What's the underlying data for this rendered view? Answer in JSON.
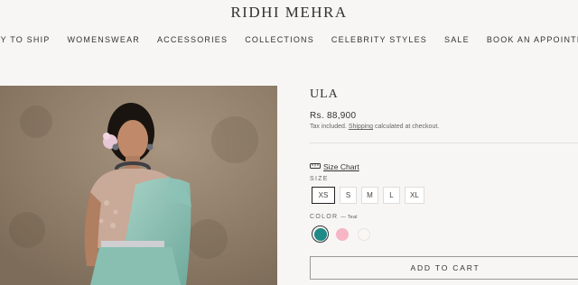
{
  "brand": "RIDHI MEHRA",
  "nav": [
    "READY TO SHIP",
    "WOMENSWEAR",
    "ACCESSORIES",
    "COLLECTIONS",
    "CELEBRITY STYLES",
    "SALE",
    "BOOK AN APPOINTMENT"
  ],
  "product": {
    "title": "ULA",
    "price": "Rs. 88,900",
    "tax_prefix": "Tax included.",
    "shipping_link": "Shipping",
    "tax_suffix": "calculated at checkout.",
    "size_chart": "Size Chart",
    "size_label": "SIZE",
    "sizes": [
      "XS",
      "S",
      "M",
      "L",
      "XL"
    ],
    "selected_size": "XS",
    "color_label": "COLOR",
    "color_value": "— Teal",
    "colors": [
      {
        "name": "Teal",
        "hex": "#1f8a87"
      },
      {
        "name": "Pink",
        "hex": "#f6b6c6"
      },
      {
        "name": "Ivory",
        "hex": "#f9f7f3"
      }
    ],
    "add_to_cart": "ADD TO CART"
  },
  "icons": {
    "size_chart": "ruler-icon"
  }
}
